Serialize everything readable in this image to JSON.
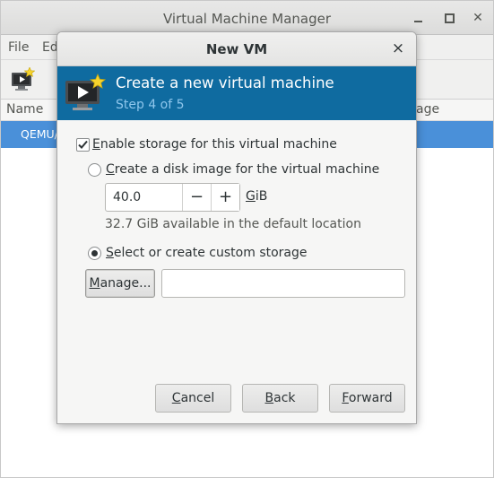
{
  "main_window": {
    "title": "Virtual Machine Manager",
    "menu": [
      "File",
      "Ed"
    ],
    "columns": {
      "name": "Name",
      "usage": "age"
    },
    "selected_row": "QEMU/K"
  },
  "dialog": {
    "title": "New VM",
    "close_glyph": "×",
    "banner": {
      "title": "Create a new virtual machine",
      "step": "Step 4 of 5"
    },
    "enable_storage": {
      "checked": true,
      "mnemonic": "E",
      "label_rest": "nable storage for this virtual machine"
    },
    "option_disk_image": {
      "selected": false,
      "mnemonic": "C",
      "label_rest": "reate a disk image for the virtual machine"
    },
    "disk_size": {
      "value": "40.0",
      "minus": "−",
      "plus": "+",
      "unit_mnemonic": "G",
      "unit_rest": "iB"
    },
    "available_text": "32.7 GiB available in the default location",
    "option_custom": {
      "selected": true,
      "mnemonic": "S",
      "label_rest": "elect or create custom storage"
    },
    "manage_button": {
      "mnemonic": "M",
      "label_rest": "anage..."
    },
    "storage_path": {
      "value": ""
    },
    "buttons": {
      "cancel": {
        "mnemonic": "C",
        "label_rest": "ancel"
      },
      "back": {
        "mnemonic": "B",
        "label_rest": "ack"
      },
      "forward": {
        "mnemonic": "F",
        "label_rest": "orward"
      }
    }
  }
}
